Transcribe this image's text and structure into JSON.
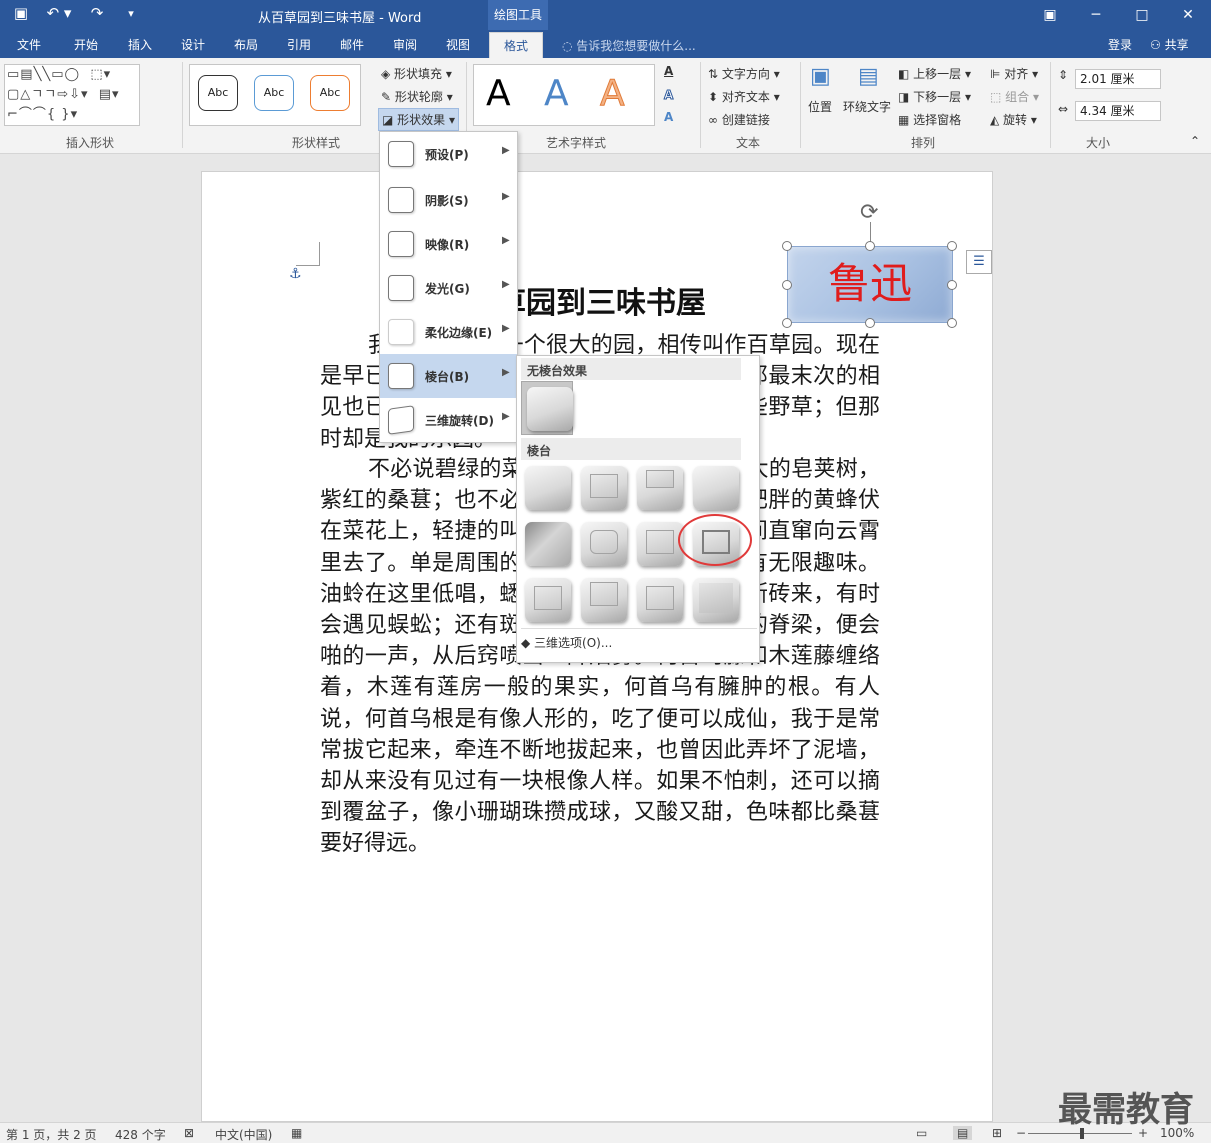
{
  "titlebar": {
    "title": "从百草园到三味书屋 - Word",
    "context_tab": "绘图工具",
    "qat": {
      "save": "▣",
      "undo": "↶ ▾",
      "redo": "↷",
      "customize": "▾"
    },
    "window": {
      "ribbon_options": "▣",
      "minimize": "─",
      "maximize": "□",
      "close": "✕"
    }
  },
  "tabs": [
    "文件",
    "开始",
    "插入",
    "设计",
    "布局",
    "引用",
    "邮件",
    "审阅",
    "视图",
    "格式"
  ],
  "tell_me": "告诉我您想要做什么...",
  "account": {
    "login": "登录",
    "share": "共享"
  },
  "ribbon": {
    "insert_shapes": {
      "label": "插入形状",
      "shapes_glyphs": "▭▤╲╲▭◯  ⬚▾\n▢△ㄱㄱ⇨⇩▾  ▤▾\n⌐⌒⌒{ }▾"
    },
    "shape_styles": {
      "label": "形状样式",
      "preset_text": "Abc",
      "fill": "形状填充",
      "outline": "形状轮廓",
      "effects": "形状效果"
    },
    "wordart": {
      "label": "艺术字样式",
      "glyph": "A",
      "text_fill": "A",
      "text_outline": "A",
      "text_effects": "A"
    },
    "text": {
      "label": "文本",
      "direction": "文字方向",
      "align": "对齐文本",
      "link": "创建链接"
    },
    "arrange": {
      "label": "排列",
      "position": "位置",
      "wrap": "环绕文字",
      "forward": "上移一层",
      "backward": "下移一层",
      "selection_pane": "选择窗格",
      "align": "对齐",
      "group": "组合",
      "rotate": "旋转"
    },
    "size": {
      "label": "大小",
      "height": "2.01 厘米",
      "width": "4.34 厘米"
    }
  },
  "document": {
    "title": "从百草园到三味书屋",
    "shape_text": "鲁迅",
    "paragraphs": [
      "我家的后面有一个很大的园，相传叫作百草园。现在是早已并屋子一起卖给朱文公的子孙了，连那最末次的相见也已经隔了七八年，其中似乎确凿只有一些野草；但那时却是我的乐园。",
      "不必说碧绿的菜畦，光滑的石井栏，高大的皂荚树，紫红的桑葚；也不必说鸣蝉在树叶里长吟，肥胖的黄蜂伏在菜花上，轻捷的叫天子（云雀）忽然从草间直窜向云霄里去了。单是周围的短短的泥墙根一带，就有无限趣味。油蛉在这里低唱，蟋蟀们在这里弹琴。翻开断砖来，有时会遇见蜈蚣；还有斑蝥，倘若用手指按住它的脊梁，便会啪的一声，从后窍喷出一阵烟雾。何首乌藤和木莲藤缠络着，木莲有莲房一般的果实，何首乌有臃肿的根。有人说，何首乌根是有像人形的，吃了便可以成仙，我于是常常拔它起来，牵连不断地拔起来，也曾因此弄坏了泥墙，却从来没有见过有一块根像人样。如果不怕刺，还可以摘到覆盆子，像小珊瑚珠攒成球，又酸又甜，色味都比桑葚要好得远。"
    ]
  },
  "effects_menu": {
    "items": [
      {
        "label": "预设(P)"
      },
      {
        "label": "阴影(S)"
      },
      {
        "label": "映像(R)"
      },
      {
        "label": "发光(G)"
      },
      {
        "label": "柔化边缘(E)"
      },
      {
        "label": "棱台(B)"
      },
      {
        "label": "三维旋转(D)"
      }
    ],
    "active_index": 5
  },
  "bevel_submenu": {
    "no_bevel_header": "无棱台效果",
    "bevel_header": "棱台",
    "options_link": "三维选项(O)...",
    "highlighted_cell": "row 2, col 4"
  },
  "statusbar": {
    "page": "第 1 页，共 2 页",
    "words": "428 个字",
    "language": "中文(中国)",
    "zoom": "100%",
    "zoom_minus": "−",
    "zoom_plus": "+"
  },
  "watermark": "最需教育",
  "colors": {
    "accent": "#2b579a",
    "shape_text": "#e01c1c",
    "highlight": "#c5d7ee",
    "circle": "#e03a3a"
  }
}
